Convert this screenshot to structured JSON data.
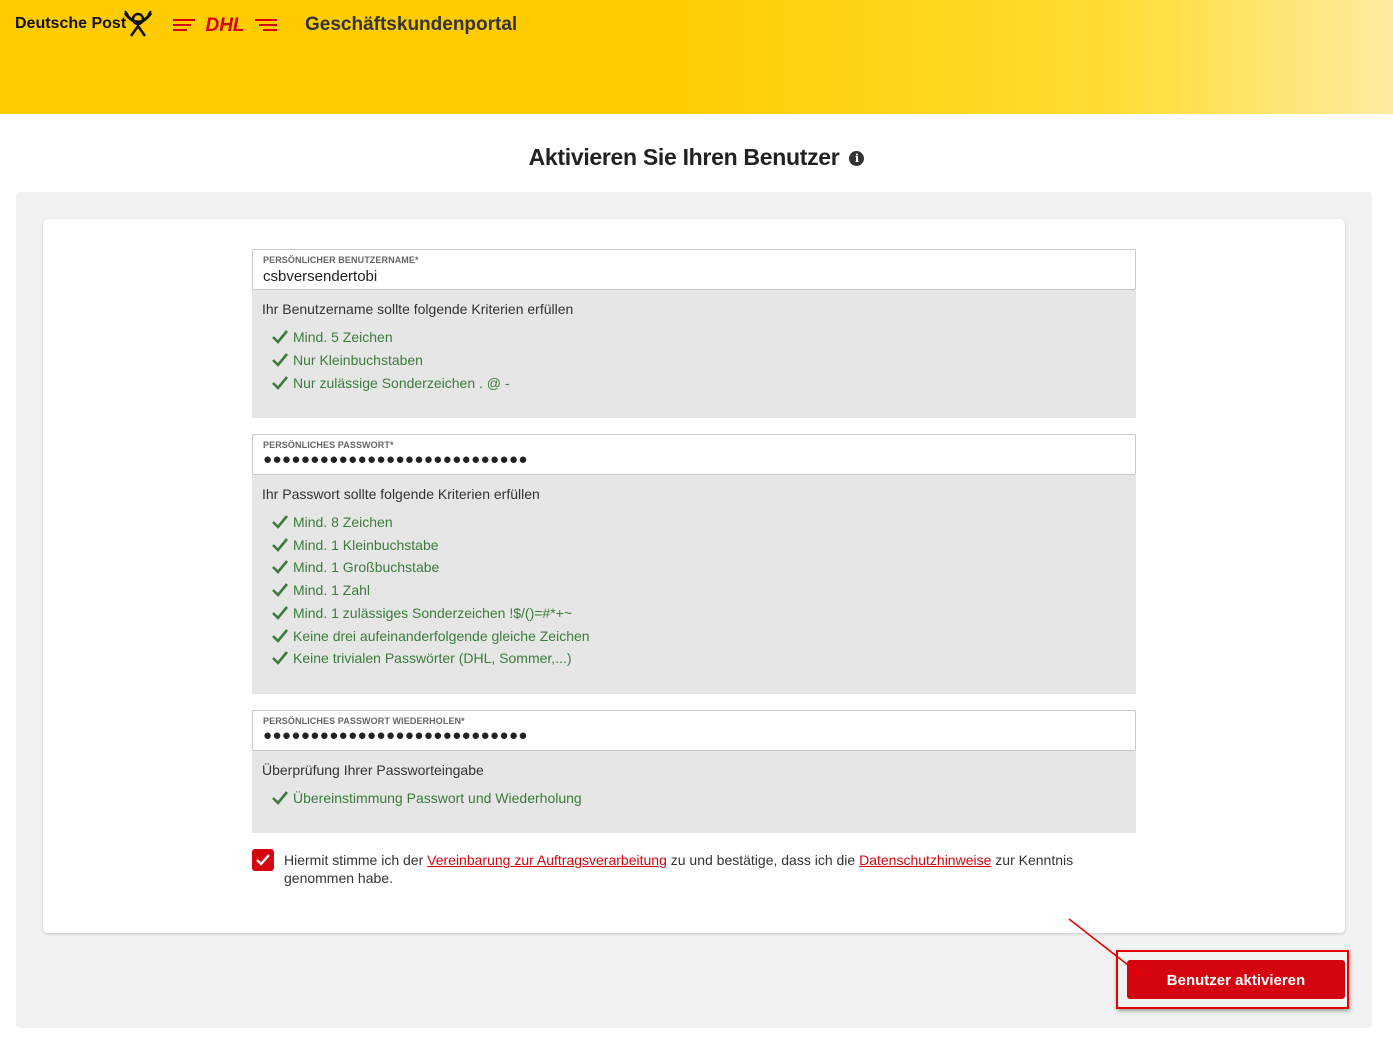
{
  "header": {
    "brand": "Deutsche Post",
    "dhl_logo": "DHL",
    "portal_title": "Geschäftskundenportal",
    "colors": {
      "yellow": "#ffcc00",
      "red": "#d40511"
    }
  },
  "page": {
    "title": "Aktivieren Sie Ihren Benutzer",
    "info_icon": "i"
  },
  "username": {
    "label": "PERSÖNLICHER BENUTZERNAME*",
    "value": "csbversendertobi",
    "criteria_title": "Ihr Benutzername sollte folgende Kriterien erfüllen",
    "criteria": [
      "Mind. 5 Zeichen",
      "Nur Kleinbuchstaben",
      "Nur zulässige Sonderzeichen . @ -"
    ]
  },
  "password": {
    "label": "PERSÖNLICHES PASSWORT*",
    "masked_value": "●●●●●●●●●●●●●●●●●●●●●●●●●●●●",
    "criteria_title": "Ihr Passwort sollte folgende Kriterien erfüllen",
    "criteria": [
      "Mind. 8 Zeichen",
      "Mind. 1 Kleinbuchstabe",
      "Mind. 1 Großbuchstabe",
      "Mind. 1 Zahl",
      "Mind. 1 zulässiges Sonderzeichen !$/()=#*+~",
      "Keine drei aufeinanderfolgende gleiche Zeichen",
      "Keine trivialen Passwörter (DHL, Sommer,...)"
    ]
  },
  "password_repeat": {
    "label": "PERSÖNLICHES PASSWORT WIEDERHOLEN*",
    "masked_value": "●●●●●●●●●●●●●●●●●●●●●●●●●●●●",
    "criteria_title": "Überprüfung Ihrer Passworteingabe",
    "criteria": [
      "Übereinstimmung Passwort und Wiederholung"
    ]
  },
  "consent": {
    "checked": true,
    "text_before": "Hiermit stimme ich der ",
    "link1": "Vereinbarung zur Auftragsverarbeitung",
    "text_middle": " zu und bestätige, dass ich die ",
    "link2": "Datenschutzhinweise",
    "text_after": " zur Kenntnis genommen habe."
  },
  "actions": {
    "activate_label": "Benutzer aktivieren"
  }
}
